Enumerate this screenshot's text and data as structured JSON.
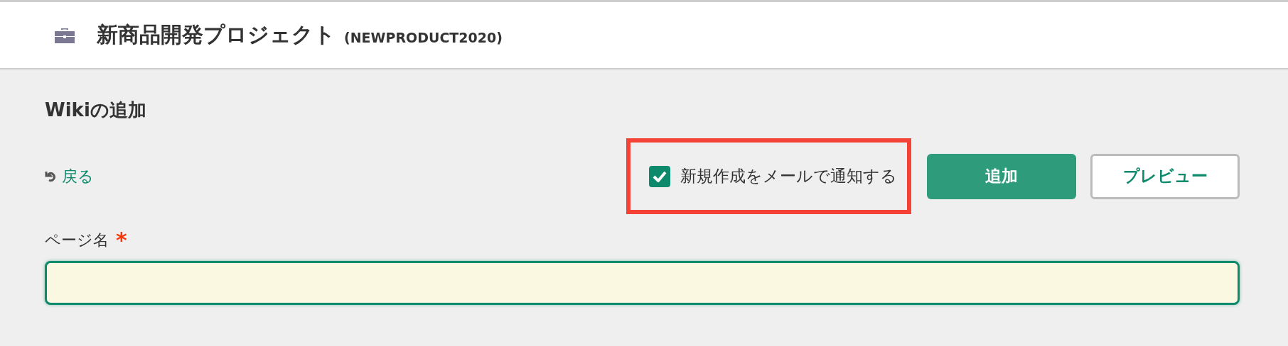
{
  "header": {
    "title": "新商品開発プロジェクト",
    "code": "(NEWPRODUCT2020)"
  },
  "section_title": "Wikiの追加",
  "back_link": "戻る",
  "notify": {
    "label": "新規作成をメールで通知する",
    "checked": true,
    "highlighted": true
  },
  "buttons": [
    {
      "label": "追加",
      "kind": "primary"
    },
    {
      "label": "プレビュー",
      "kind": "secondary"
    }
  ],
  "page_name": {
    "label": "ページ名",
    "required_mark": "*",
    "required": true
  }
}
